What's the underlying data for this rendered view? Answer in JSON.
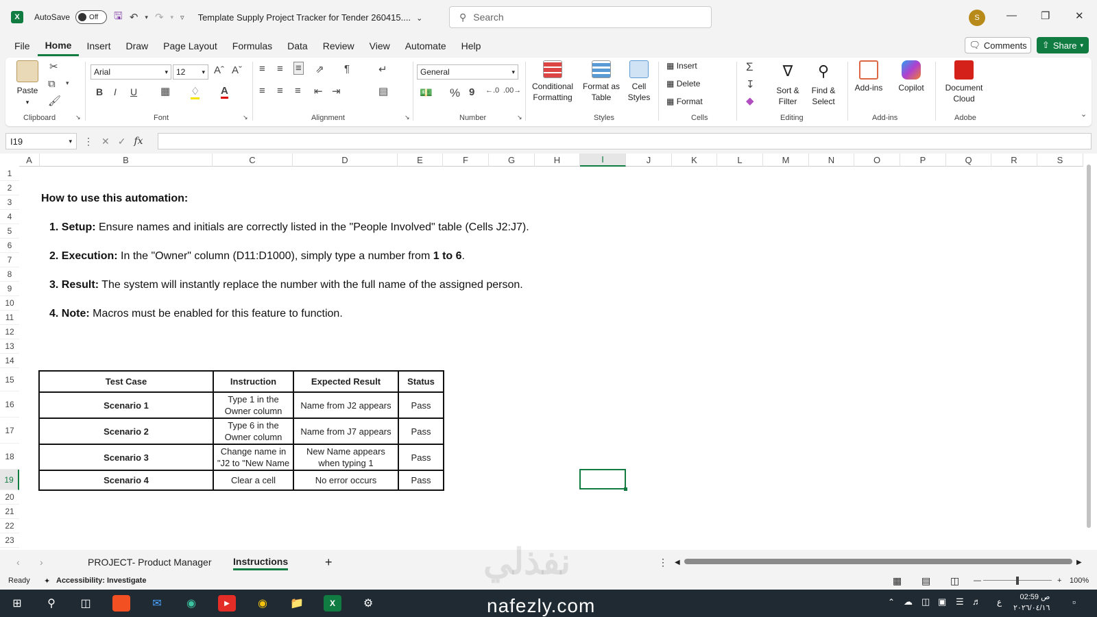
{
  "titlebar": {
    "autosave_label": "AutoSave",
    "autosave_state": "Off",
    "doc_title": "Template Supply Project Tracker for Tender 260415....",
    "search_placeholder": "Search",
    "avatar_initial": "S"
  },
  "menu": {
    "tabs": [
      "File",
      "Home",
      "Insert",
      "Draw",
      "Page Layout",
      "Formulas",
      "Data",
      "Review",
      "View",
      "Automate",
      "Help"
    ],
    "active": "Home",
    "comments_label": "Comments",
    "share_label": "Share"
  },
  "ribbon": {
    "clipboard": {
      "paste": "Paste",
      "label": "Clipboard"
    },
    "font": {
      "family": "Arial",
      "size": "12",
      "label": "Font",
      "bold": "B",
      "italic": "I",
      "underline": "U"
    },
    "alignment": {
      "label": "Alignment"
    },
    "number": {
      "format": "General",
      "label": "Number",
      "percent": "%",
      "comma": "9"
    },
    "styles": {
      "conditional": "Conditional Formatting",
      "format_table": "Format as Table",
      "cell_styles": "Cell Styles",
      "label": "Styles"
    },
    "cells": {
      "insert": "Insert",
      "delete": "Delete",
      "format": "Format",
      "label": "Cells"
    },
    "editing": {
      "sort_filter": "Sort & Filter",
      "find_select": "Find & Select",
      "label": "Editing"
    },
    "addins": {
      "addins": "Add-ins",
      "label": "Add-ins"
    },
    "copilot": {
      "copilot": "Copilot"
    },
    "adobe": {
      "doc_cloud": "Document Cloud",
      "label": "Adobe"
    }
  },
  "formula_bar": {
    "name_box": "I19",
    "fx": "fx",
    "value": ""
  },
  "grid": {
    "columns": [
      "A",
      "B",
      "C",
      "D",
      "E",
      "F",
      "G",
      "H",
      "I",
      "J",
      "K",
      "L",
      "M",
      "N",
      "O",
      "P",
      "Q",
      "R",
      "S"
    ],
    "selected_column": "I",
    "rows": [
      "1",
      "2",
      "3",
      "4",
      "5",
      "6",
      "7",
      "8",
      "9",
      "10",
      "11",
      "12",
      "13",
      "14",
      "15",
      "16",
      "17",
      "18",
      "19",
      "20",
      "21",
      "22",
      "23"
    ],
    "selected_row": "19"
  },
  "instructions": {
    "heading": "How to use this automation:",
    "steps": [
      {
        "label": "1. Setup:",
        "text": " Ensure names and initials are correctly listed in the \"People Involved\" table (Cells J2:J7)."
      },
      {
        "label": "2. Execution:",
        "text": " In the \"Owner\" column (D11:D1000), simply type a number from ",
        "bold_tail": "1 to 6",
        "end": "."
      },
      {
        "label": "3. Result:",
        "text": " The system will instantly replace the number with the full name of the assigned person."
      },
      {
        "label": "4. Note:",
        "text": " Macros must be enabled for this feature to function."
      }
    ]
  },
  "test_table": {
    "headers": [
      "Test Case",
      "Instruction",
      "Expected Result",
      "Status"
    ],
    "rows": [
      [
        "Scenario 1",
        "Type 1 in the Owner column",
        "Name from J2 appears",
        "Pass"
      ],
      [
        "Scenario 2",
        "Type 6 in the Owner column",
        "Name from J7 appears",
        "Pass"
      ],
      [
        "Scenario 3",
        "Change name in \"J2 to \"New Name",
        "New Name appears when typing 1",
        "Pass"
      ],
      [
        "Scenario 4",
        "Clear a cell",
        "No error occurs",
        "Pass"
      ]
    ]
  },
  "sheets": {
    "tabs": [
      "PROJECT- Product Manager",
      "Instructions"
    ],
    "active": "Instructions",
    "add": "+"
  },
  "status": {
    "ready": "Ready",
    "accessibility": "Accessibility: Investigate",
    "zoom": "100%"
  },
  "taskbar": {
    "watermark": "nafezly.com",
    "watermark_ar": "نفذلي",
    "time": "02:59 ص",
    "date": "٢٠٢٦/٠٤/١٦",
    "lang": "ع"
  }
}
